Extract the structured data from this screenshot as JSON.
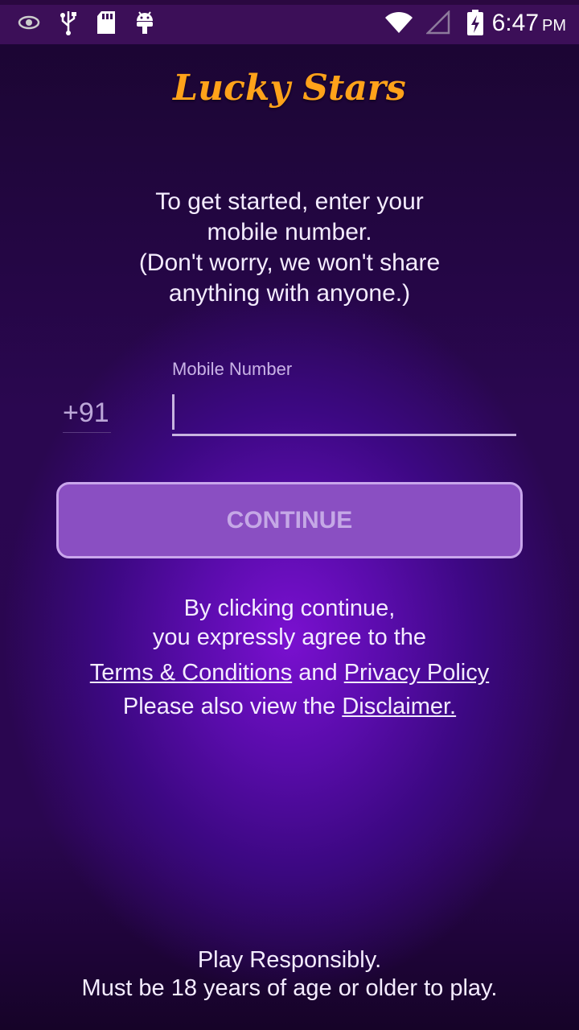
{
  "status_bar": {
    "time": "6:47",
    "ampm": "PM",
    "icons": [
      "eye-icon",
      "usb-icon",
      "sd-card-icon",
      "android-icon",
      "wifi-icon",
      "signal-icon",
      "battery-charging-icon"
    ]
  },
  "app": {
    "logo": "Lucky Stars"
  },
  "intro": {
    "line1": "To get started, enter your",
    "line2": "mobile number.",
    "line3": "(Don't worry, we won't share",
    "line4": "anything with anyone.)"
  },
  "form": {
    "country_code": "+91",
    "mobile_label": "Mobile Number",
    "mobile_value": "",
    "continue_label": "CONTINUE"
  },
  "legal": {
    "line1": "By clicking continue,",
    "line2": "you expressly agree to the",
    "terms_link": "Terms & Conditions",
    "and": "and",
    "privacy_link": "Privacy Policy",
    "view_prefix": "Please also view the",
    "disclaimer_link": "Disclaimer."
  },
  "footer": {
    "line1": "Play Responsibly.",
    "line2": "Must be 18 years of age or older to play."
  },
  "colors": {
    "logo": "#ffa21a",
    "button_bg": "#8a4fc2",
    "button_border": "#c9a6ec"
  }
}
